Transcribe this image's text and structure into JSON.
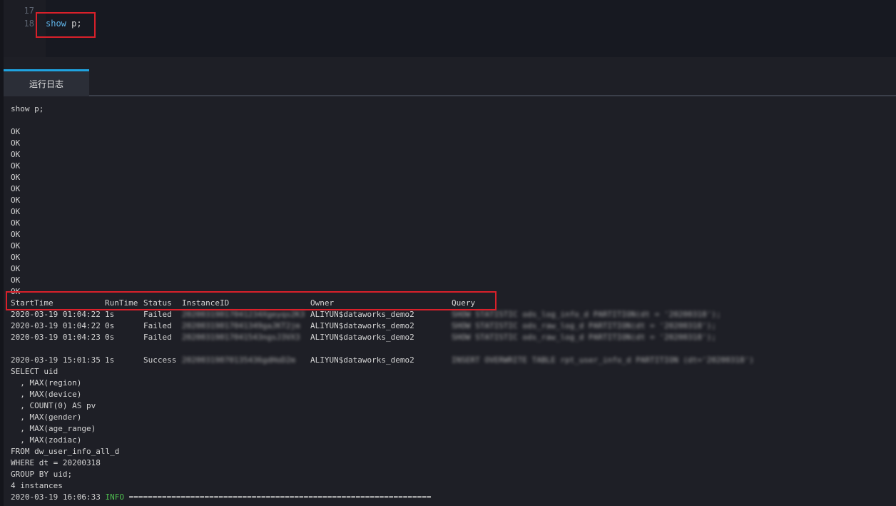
{
  "editor": {
    "line_numbers": [
      "17",
      "18"
    ],
    "keyword": "show",
    "rest": " p;"
  },
  "panel": {
    "tab_label": "运行日志"
  },
  "log": {
    "command": "show p;",
    "ok_lines": [
      "OK",
      "OK",
      "OK",
      "OK",
      "OK",
      "OK",
      "OK",
      "OK",
      "OK",
      "OK",
      "OK",
      "OK",
      "OK",
      "OK",
      "OK"
    ],
    "table_headers": [
      "StartTime",
      "RunTime",
      "Status",
      "InstanceID",
      "Owner",
      "Query"
    ],
    "rows": [
      {
        "start": "2020-03-19 01:04:22",
        "run": "1s",
        "status": "Failed",
        "instance": "20200319017041234Xgeyqs2K3",
        "owner": "ALIYUN$dataworks_demo2",
        "query": "SHOW STATISTIC ods_log_info_d PARTITION(dt = '20200318');"
      },
      {
        "start": "2020-03-19 01:04:22",
        "run": "0s",
        "status": "Failed",
        "instance": "20200319017041349gaJKT2jm",
        "owner": "ALIYUN$dataworks_demo2",
        "query": "SHOW STATISTIC ods_raw_log_d PARTITION(dt = '20200318');"
      },
      {
        "start": "2020-03-19 01:04:23",
        "run": "0s",
        "status": "Failed",
        "instance": "20200319017041543ngsJ3VX3",
        "owner": "ALIYUN$dataworks_demo2",
        "query": "SHOW STATISTIC ods_raw_log_d PARTITION(dt = '20200318');"
      },
      {
        "start": "2020-03-19 15:01:35",
        "run": "1s",
        "status": "Success",
        "instance": "20200319070135436gdHoD2m",
        "owner": "ALIYUN$dataworks_demo2",
        "query": "INSERT OVERWRITE TABLE rpt_user_info_d PARTITION (dt='20200318')"
      }
    ],
    "sql_lines": [
      "SELECT uid",
      "  , MAX(region)",
      "  , MAX(device)",
      "  , COUNT(0) AS pv",
      "  , MAX(gender)",
      "  , MAX(age_range)",
      "  , MAX(zodiac)",
      "FROM dw_user_info_all_d",
      "WHERE dt = 20200318",
      "GROUP BY uid;"
    ],
    "instances_line": "4 instances",
    "final_timestamp": "2020-03-19 16:06:33",
    "final_level": "INFO",
    "final_rule": "================================================================"
  },
  "colors": {
    "highlight_box": "#d9202a",
    "tab_accent": "#1fa3e0",
    "keyword": "#5fb3e8",
    "info": "#4fbf4f"
  }
}
